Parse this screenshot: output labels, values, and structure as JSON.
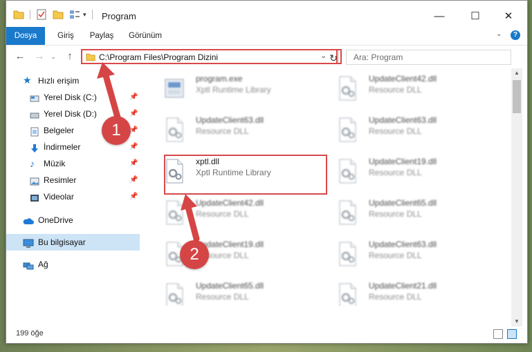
{
  "window": {
    "title": "Program",
    "minimize": "—",
    "maximize": "☐",
    "close": "✕",
    "help": "?"
  },
  "ribbon": {
    "tabs": [
      {
        "label": "Dosya"
      },
      {
        "label": "Giriş"
      },
      {
        "label": "Paylaş"
      },
      {
        "label": "Görünüm"
      }
    ]
  },
  "address": {
    "path": "C:\\Program Files\\Program Dizini",
    "search_placeholder": "Ara: Program"
  },
  "sidebar": {
    "quick_access": "Hızlı erişim",
    "items": [
      {
        "label": "Yerel Disk (C:)",
        "icon": "drive-icon"
      },
      {
        "label": "Yerel Disk (D:)",
        "icon": "drive-icon"
      },
      {
        "label": "Belgeler",
        "icon": "documents-icon"
      },
      {
        "label": "İndirmeler",
        "icon": "download-icon"
      },
      {
        "label": "Müzik",
        "icon": "music-icon"
      },
      {
        "label": "Resimler",
        "icon": "pictures-icon"
      },
      {
        "label": "Videolar",
        "icon": "video-icon"
      }
    ],
    "onedrive": "OneDrive",
    "this_pc": "Bu bilgisayar",
    "network": "Ağ"
  },
  "files": [
    {
      "name": "program.exe",
      "desc": "Xptl Runtime Library",
      "col": 0,
      "row": 0
    },
    {
      "name": "UpdateClient42.dll",
      "desc": "Resource DLL",
      "col": 1,
      "row": 0
    },
    {
      "name": "UpdateClient63.dll",
      "desc": "Resource DLL",
      "col": 0,
      "row": 1
    },
    {
      "name": "UpdateClient63.dll",
      "desc": "Resource DLL",
      "col": 1,
      "row": 1
    },
    {
      "name": "xptl.dll",
      "desc": "Xptl Runtime Library",
      "col": 0,
      "row": 2
    },
    {
      "name": "UpdateClient19.dll",
      "desc": "Resource DLL",
      "col": 1,
      "row": 2
    },
    {
      "name": "UpdateClient42.dll",
      "desc": "Resource DLL",
      "col": 0,
      "row": 3
    },
    {
      "name": "UpdateClient65.dll",
      "desc": "Resource DLL",
      "col": 1,
      "row": 3
    },
    {
      "name": "UpdateClient19.dll",
      "desc": "Resource DLL",
      "col": 0,
      "row": 4
    },
    {
      "name": "UpdateClient63.dll",
      "desc": "Resource DLL",
      "col": 1,
      "row": 4
    },
    {
      "name": "UpdateClient65.dll",
      "desc": "Resource DLL",
      "col": 0,
      "row": 5
    },
    {
      "name": "UpdateClient21.dll",
      "desc": "Resource DLL",
      "col": 1,
      "row": 5
    }
  ],
  "status": {
    "count": "199 öğe"
  },
  "annotations": {
    "step1": "1",
    "step2": "2",
    "color": "#d64545"
  }
}
